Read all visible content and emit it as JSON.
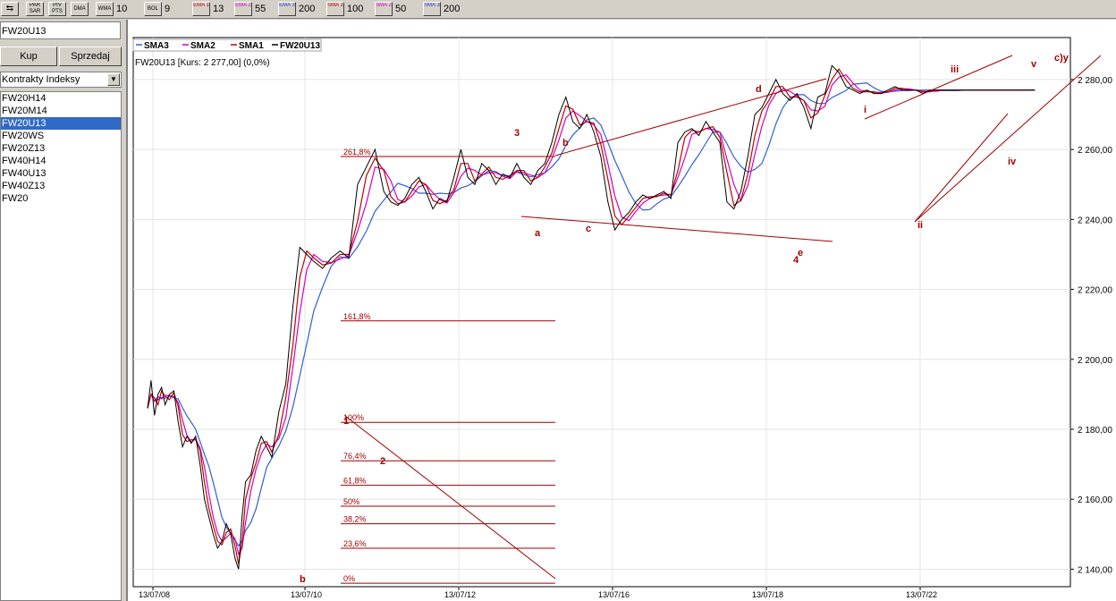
{
  "toolbar": {
    "items": [
      {
        "icon": "zoom-icon",
        "label": "",
        "value": ""
      },
      {
        "icon": "par-sar-icon",
        "label": "PAR SAR",
        "value": ""
      },
      {
        "icon": "piv-pts-icon",
        "label": "PIV PTS",
        "value": ""
      },
      {
        "icon": "dma-icon",
        "label": "DMA",
        "value": ""
      },
      {
        "icon": "wma-icon",
        "label": "WMA",
        "value": "10"
      },
      {
        "icon": "bol-icon",
        "label": "BOL",
        "value": "9"
      },
      {
        "icon": "ema1-icon",
        "label": "EMA 1",
        "value": "13"
      },
      {
        "icon": "ema2-icon",
        "label": "EMA 2",
        "value": "55"
      },
      {
        "icon": "ema3-icon",
        "label": "EMA 3",
        "value": "200"
      },
      {
        "icon": "sma1-icon",
        "label": "SMA 1",
        "value": "100"
      },
      {
        "icon": "sma2-icon",
        "label": "SMA 2",
        "value": "50"
      },
      {
        "icon": "sma3-icon",
        "label": "SMA 3",
        "value": "200"
      }
    ]
  },
  "sidebar": {
    "title": "FW20U13",
    "buy_label": "Kup",
    "sell_label": "Sprzedaj",
    "combo_value": "Kontrakty Indeksy",
    "instruments": [
      "FW20H14",
      "FW20M14",
      "FW20U13",
      "FW20WS",
      "FW20Z13",
      "FW40H14",
      "FW40U13",
      "FW40Z13",
      "FW20"
    ],
    "selected_index": 2
  },
  "colors": {
    "sma3": "#3060d0",
    "sma2": "#d000c0",
    "sma1": "#c00000",
    "price": "#000000",
    "annotation": "#a00000",
    "selection": "#3169c6"
  },
  "chart_data": {
    "type": "line",
    "legend": [
      "SMA3",
      "SMA2",
      "SMA1",
      "FW20U13"
    ],
    "legend_position": "top-left",
    "info": "FW20U13 [Kurs: 2 277,00] (0,0%)",
    "ylim": [
      2135,
      2292
    ],
    "yticks": [
      "2 140,00",
      "2 160,00",
      "2 180,00",
      "2 200,00",
      "2 220,00",
      "2 240,00",
      "2 260,00",
      "2 280,00"
    ],
    "ytick_values": [
      2140,
      2160,
      2180,
      2200,
      2220,
      2240,
      2260,
      2280
    ],
    "xticks": [
      "13/07/08",
      "13/07/10",
      "13/07/12",
      "13/07/16",
      "13/07/18",
      "13/07/22"
    ],
    "grid": true,
    "price_series": {
      "name": "FW20U13",
      "x": [
        0,
        4,
        8,
        12,
        16,
        20,
        25,
        30,
        35,
        40,
        45,
        50,
        55,
        60,
        65,
        70,
        75,
        80,
        85,
        90,
        95,
        100,
        104,
        108,
        112,
        118,
        124,
        130,
        136,
        142,
        150,
        158,
        166,
        174,
        182,
        190,
        200,
        210,
        220,
        230,
        240,
        250,
        260,
        270,
        278,
        286,
        294,
        302,
        310,
        318,
        326,
        334,
        342,
        350,
        358,
        366,
        374,
        382,
        390,
        398,
        406,
        414,
        422,
        430,
        438,
        446,
        454,
        462,
        470,
        478,
        486,
        494,
        502,
        510,
        518,
        526,
        534,
        542,
        550,
        558,
        566,
        574,
        582,
        590,
        598,
        606,
        614,
        622,
        630,
        638,
        646,
        654,
        662,
        670,
        678,
        686,
        694,
        702,
        710,
        718,
        726,
        734,
        742,
        750,
        758,
        766,
        774,
        782,
        790,
        798,
        806,
        814,
        822,
        830,
        838,
        846,
        854,
        862,
        870,
        878,
        886,
        894,
        902,
        910,
        918,
        926,
        934,
        942,
        950,
        958,
        966,
        974,
        982,
        990,
        998,
        1006,
        1014,
        1022,
        1030
      ],
      "y": [
        2186,
        2194,
        2184,
        2190,
        2192,
        2187,
        2190,
        2191,
        2182,
        2175,
        2178,
        2176,
        2178,
        2170,
        2160,
        2155,
        2150,
        2146,
        2148,
        2153,
        2150,
        2143,
        2140,
        2155,
        2165,
        2167,
        2174,
        2178,
        2175,
        2172,
        2185,
        2193,
        2215,
        2232,
        2230,
        2228,
        2226,
        2229,
        2231,
        2229,
        2250,
        2255,
        2260,
        2248,
        2245,
        2244,
        2246,
        2250,
        2252,
        2248,
        2243,
        2246,
        2245,
        2252,
        2260,
        2252,
        2250,
        2256,
        2254,
        2250,
        2253,
        2252,
        2256,
        2252,
        2250,
        2254,
        2256,
        2262,
        2270,
        2275,
        2268,
        2266,
        2270,
        2265,
        2258,
        2245,
        2237,
        2240,
        2242,
        2245,
        2247,
        2246,
        2247,
        2248,
        2246,
        2262,
        2265,
        2266,
        2264,
        2268,
        2265,
        2262,
        2245,
        2243,
        2248,
        2258,
        2270,
        2272,
        2276,
        2280,
        2276,
        2274,
        2276,
        2272,
        2266,
        2275,
        2276,
        2284,
        2282,
        2278,
        2277,
        2276,
        2277,
        2276,
        2276,
        2277,
        2278,
        2277,
        2277,
        2277,
        2276,
        2277,
        2277,
        2277,
        2277,
        2277,
        2277,
        2277,
        2277,
        2277,
        2277,
        2277,
        2277,
        2277,
        2277,
        2277,
        2277
      ]
    },
    "fibonacci": [
      {
        "label": "261,8%",
        "value": 2258
      },
      {
        "label": "161,8%",
        "value": 2211
      },
      {
        "label": "100%",
        "value": 2182
      },
      {
        "label": "76,4%",
        "value": 2171
      },
      {
        "label": "61,8%",
        "value": 2164
      },
      {
        "label": "50%",
        "value": 2158
      },
      {
        "label": "38,2%",
        "value": 2153
      },
      {
        "label": "23,6%",
        "value": 2146
      },
      {
        "label": "0%",
        "value": 2136
      }
    ],
    "wave_labels": [
      "1",
      "2",
      "3",
      "4",
      "a",
      "b",
      "c",
      "d",
      "e",
      "i",
      "ii",
      "iii",
      "iv",
      "v",
      "c)y"
    ]
  }
}
